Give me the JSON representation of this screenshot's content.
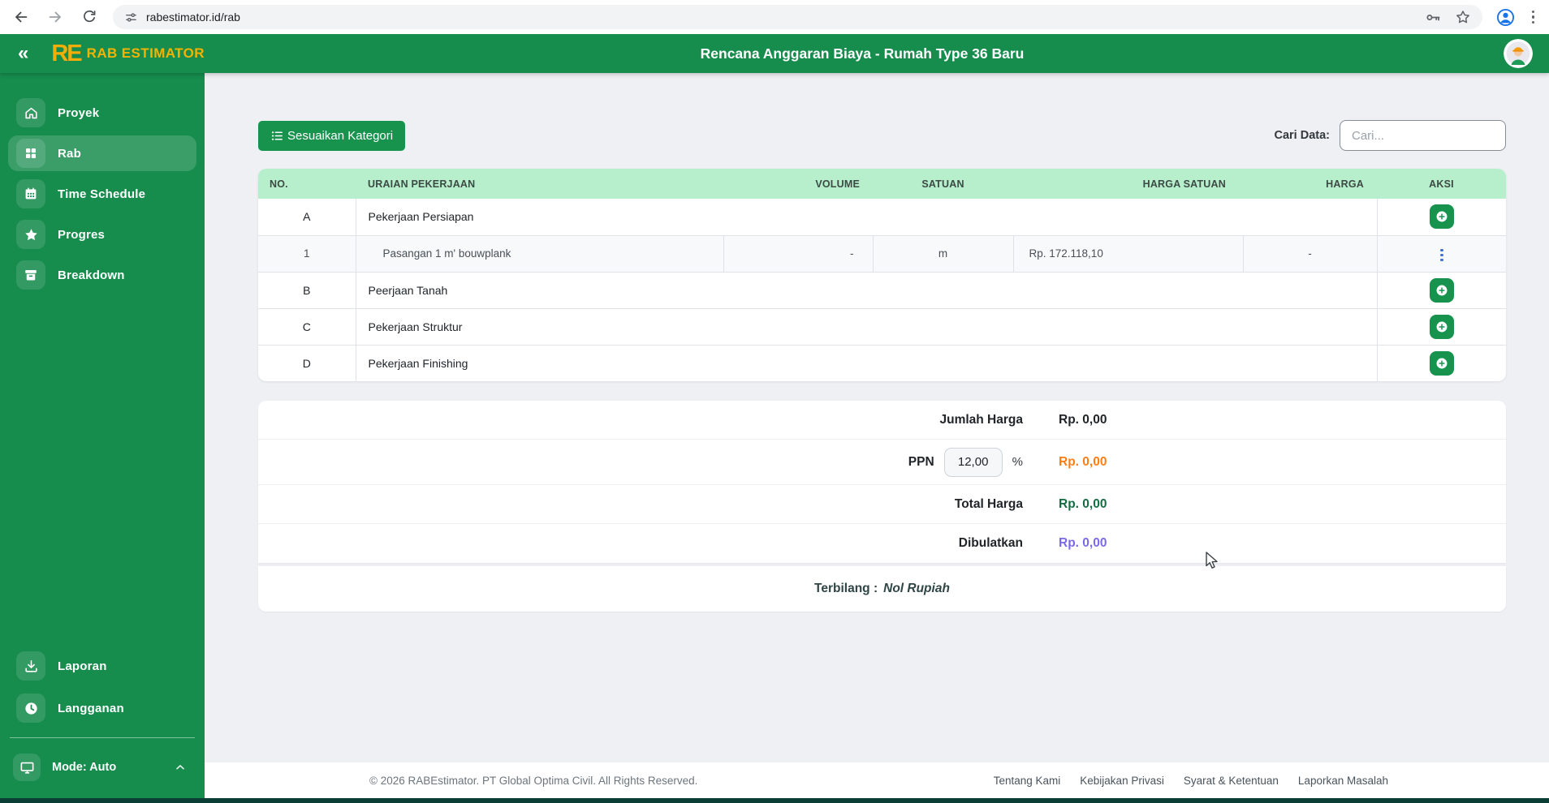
{
  "browser": {
    "url": "rabestimator.id/rab"
  },
  "header": {
    "collapse_glyph": "«",
    "logo_text": "RE",
    "brand": "RAB ESTIMATOR",
    "title": "Rencana Anggaran Biaya - Rumah Type 36 Baru"
  },
  "sidebar": {
    "items": [
      {
        "label": "Proyek",
        "icon": "home-icon",
        "active": false
      },
      {
        "label": "Rab",
        "icon": "grid-icon",
        "active": true
      },
      {
        "label": "Time Schedule",
        "icon": "calendar-icon",
        "active": false
      },
      {
        "label": "Progres",
        "icon": "star-icon",
        "active": false
      },
      {
        "label": "Breakdown",
        "icon": "archive-icon",
        "active": false
      }
    ],
    "bottom_items": [
      {
        "label": "Laporan",
        "icon": "download-icon"
      },
      {
        "label": "Langganan",
        "icon": "clock-icon"
      }
    ],
    "mode_label": "Mode: Auto"
  },
  "toolbar": {
    "adjust_category_label": "Sesuaikan Kategori",
    "search_label": "Cari Data:",
    "search_placeholder": "Cari..."
  },
  "table": {
    "headers": [
      "NO.",
      "URAIAN PEKERJAAN",
      "VOLUME",
      "SATUAN",
      "HARGA SATUAN",
      "HARGA",
      "AKSI"
    ],
    "rows": [
      {
        "type": "category",
        "no": "A",
        "uraian": "Pekerjaan Persiapan"
      },
      {
        "type": "item",
        "no": "1",
        "uraian": "Pasangan 1 m' bouwplank",
        "volume": "-",
        "satuan": "m",
        "harga_satuan": "Rp. 172.118,10",
        "harga": "-"
      },
      {
        "type": "category",
        "no": "B",
        "uraian": "Peerjaan Tanah"
      },
      {
        "type": "category",
        "no": "C",
        "uraian": "Pekerjaan Struktur"
      },
      {
        "type": "category",
        "no": "D",
        "uraian": "Pekerjaan Finishing"
      }
    ]
  },
  "summary": {
    "jumlah_label": "Jumlah Harga",
    "jumlah_value": "Rp. 0,00",
    "ppn_label": "PPN",
    "ppn_value": "12,00",
    "ppn_unit": "%",
    "ppn_amount": "Rp. 0,00",
    "total_label": "Total Harga",
    "total_value": "Rp. 0,00",
    "dibulatkan_label": "Dibulatkan",
    "dibulatkan_value": "Rp. 0,00",
    "terbilang_label": "Terbilang :",
    "terbilang_value": "Nol Rupiah"
  },
  "footer": {
    "copyright": "© 2026 RABEstimator. PT Global Optima Civil. All Rights Reserved.",
    "links": [
      "Tentang Kami",
      "Kebijakan Privasi",
      "Syarat & Ketentuan",
      "Laporkan Masalah"
    ]
  },
  "colors": {
    "primary_green": "#168c4d",
    "button_green": "#17934e",
    "table_header_mint": "#b7efcd",
    "brand_yellow": "#f5b301",
    "ppn_amount": "#fd7e14",
    "total_value": "#146c43",
    "dibulatkan_value": "#7a6ae8",
    "kebab_blue": "#3e6ed0"
  }
}
